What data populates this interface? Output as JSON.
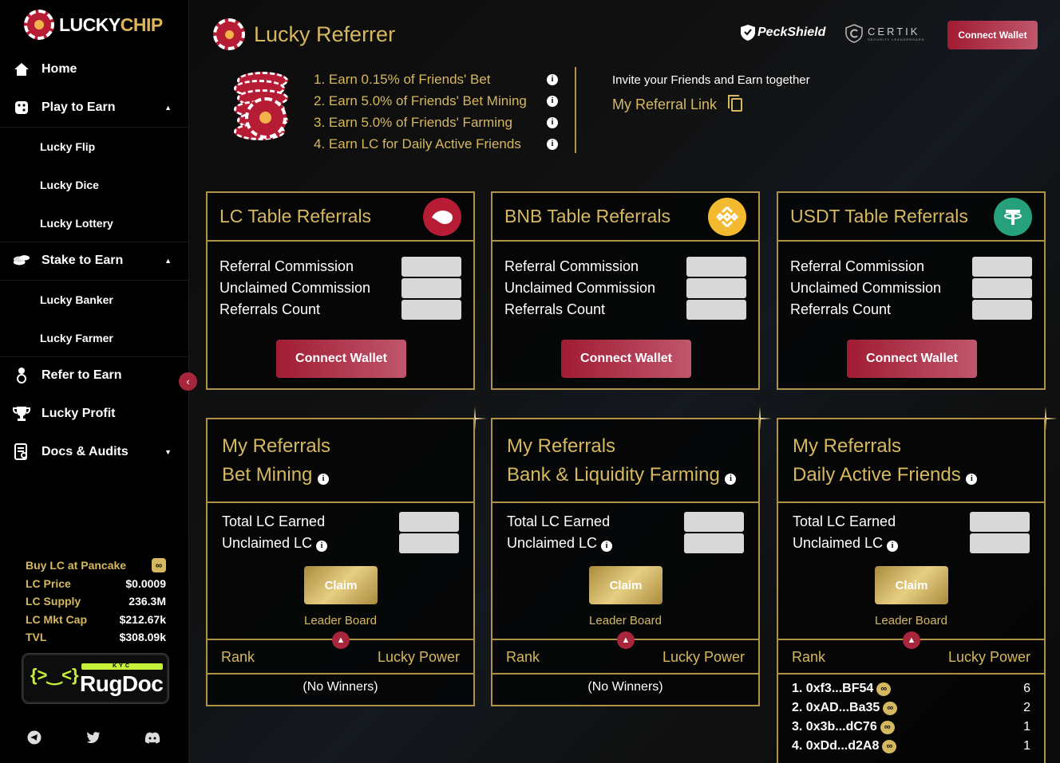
{
  "brand": {
    "logo_white": "LUCKY",
    "logo_gold": "CHIP"
  },
  "sidebar": {
    "items": [
      {
        "label": "Home",
        "icon": "home-icon"
      },
      {
        "label": "Play to Earn",
        "icon": "dice-icon"
      },
      {
        "label": "Stake to Earn",
        "icon": "coins-icon"
      },
      {
        "label": "Refer to Earn",
        "icon": "users-icon"
      },
      {
        "label": "Lucky Profit",
        "icon": "trophy-icon"
      },
      {
        "label": "Docs & Audits",
        "icon": "docs-icon"
      }
    ],
    "play_sub": [
      "Lucky Flip",
      "Lucky Dice",
      "Lucky Lottery"
    ],
    "stake_sub": [
      "Lucky Banker",
      "Lucky Farmer"
    ],
    "stats": {
      "buy_label": "Buy LC at Pancake",
      "price_label": "LC Price",
      "price_value": "$0.0009",
      "supply_label": "LC Supply",
      "supply_value": "236.3M",
      "mktcap_label": "LC Mkt Cap",
      "mktcap_value": "$212.67k",
      "tvl_label": "TVL",
      "tvl_value": "$308.09k"
    },
    "rugdoc": {
      "kyc": "KYC",
      "name": "RugDoc"
    }
  },
  "header": {
    "title": "Lucky Referrer",
    "peckshield": "PeckShield",
    "certik": "CERTIK",
    "certik_sub": "SECURITY LEADERBOARD",
    "connect_wallet": "Connect Wallet"
  },
  "earn_list": [
    "1. Earn 0.15% of Friends' Bet",
    "2. Earn 5.0% of Friends' Bet Mining",
    "3. Earn 5.0% of Friends' Farming",
    "4. Earn LC for Daily Active Friends"
  ],
  "invite": {
    "text": "Invite your Friends and Earn together",
    "link": "My Referral Link"
  },
  "table_cards": [
    {
      "title": "LC Table Referrals",
      "token": "lc-token-icon",
      "color": "#b71c35"
    },
    {
      "title": "BNB Table Referrals",
      "token": "bnb-token-icon",
      "color": "#f3ba2f"
    },
    {
      "title": "USDT Table Referrals",
      "token": "usdt-token-icon",
      "color": "#26a17b"
    }
  ],
  "table_labels": {
    "commission": "Referral Commission",
    "unclaimed": "Unclaimed Commission",
    "count": "Referrals Count",
    "button": "Connect Wallet"
  },
  "ref_cards": [
    {
      "title1": "My Referrals",
      "title2": "Bet Mining",
      "empty": "(No Winners)"
    },
    {
      "title1": "My Referrals",
      "title2": "Bank & Liquidity Farming",
      "empty": "(No Winners)"
    },
    {
      "title1": "My Referrals",
      "title2": "Daily Active Friends",
      "empty": ""
    }
  ],
  "ref_labels": {
    "total": "Total LC Earned",
    "unclaimed": "Unclaimed LC",
    "claim": "Claim",
    "leader": "Leader Board",
    "rank": "Rank",
    "power": "Lucky Power"
  },
  "winners": [
    {
      "addr": "1. 0xf3...BF54",
      "power": "6"
    },
    {
      "addr": "2. 0xAD...Ba35",
      "power": "2"
    },
    {
      "addr": "3. 0x3b...dC76",
      "power": "1"
    },
    {
      "addr": "4. 0xDd...d2A8",
      "power": "1"
    }
  ]
}
